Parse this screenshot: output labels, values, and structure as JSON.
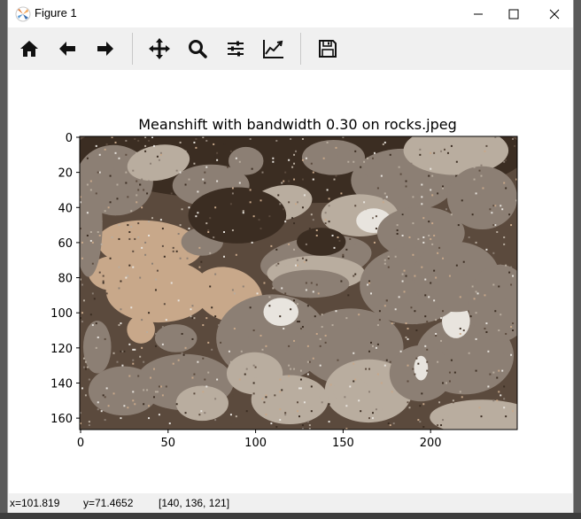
{
  "window": {
    "title": "Figure 1"
  },
  "toolbar": {
    "buttons": [
      {
        "icon": "home-icon",
        "name": "home-button"
      },
      {
        "icon": "back-arrow-icon",
        "name": "back-button"
      },
      {
        "icon": "forward-arrow-icon",
        "name": "forward-button"
      },
      {
        "icon": "pan-move-icon",
        "name": "pan-button"
      },
      {
        "icon": "zoom-magnifier-icon",
        "name": "zoom-button"
      },
      {
        "icon": "configure-subplots-icon",
        "name": "subplots-button"
      },
      {
        "icon": "edit-axis-curve-icon",
        "name": "customize-button"
      },
      {
        "icon": "save-floppy-icon",
        "name": "save-button"
      }
    ]
  },
  "plot": {
    "title": "Meanshift with bandwidth 0.30 on rocks.jpeg",
    "image_size": {
      "width": 250,
      "height": 167
    },
    "x_ticks": [
      "0",
      "50",
      "100",
      "150",
      "200"
    ],
    "y_ticks": [
      "0",
      "20",
      "40",
      "60",
      "80",
      "100",
      "120",
      "140",
      "160"
    ],
    "palette": {
      "dark": "#3b2d22",
      "mid_dark": "#5b4a3d",
      "mid": "#8c7f74",
      "light": "#b9ad9f",
      "tan": "#c8a88a",
      "highlight": "#e8e4de"
    }
  },
  "status": {
    "x": "x=101.819",
    "y": "y=71.4652",
    "rgb": "[140, 136, 121]"
  }
}
